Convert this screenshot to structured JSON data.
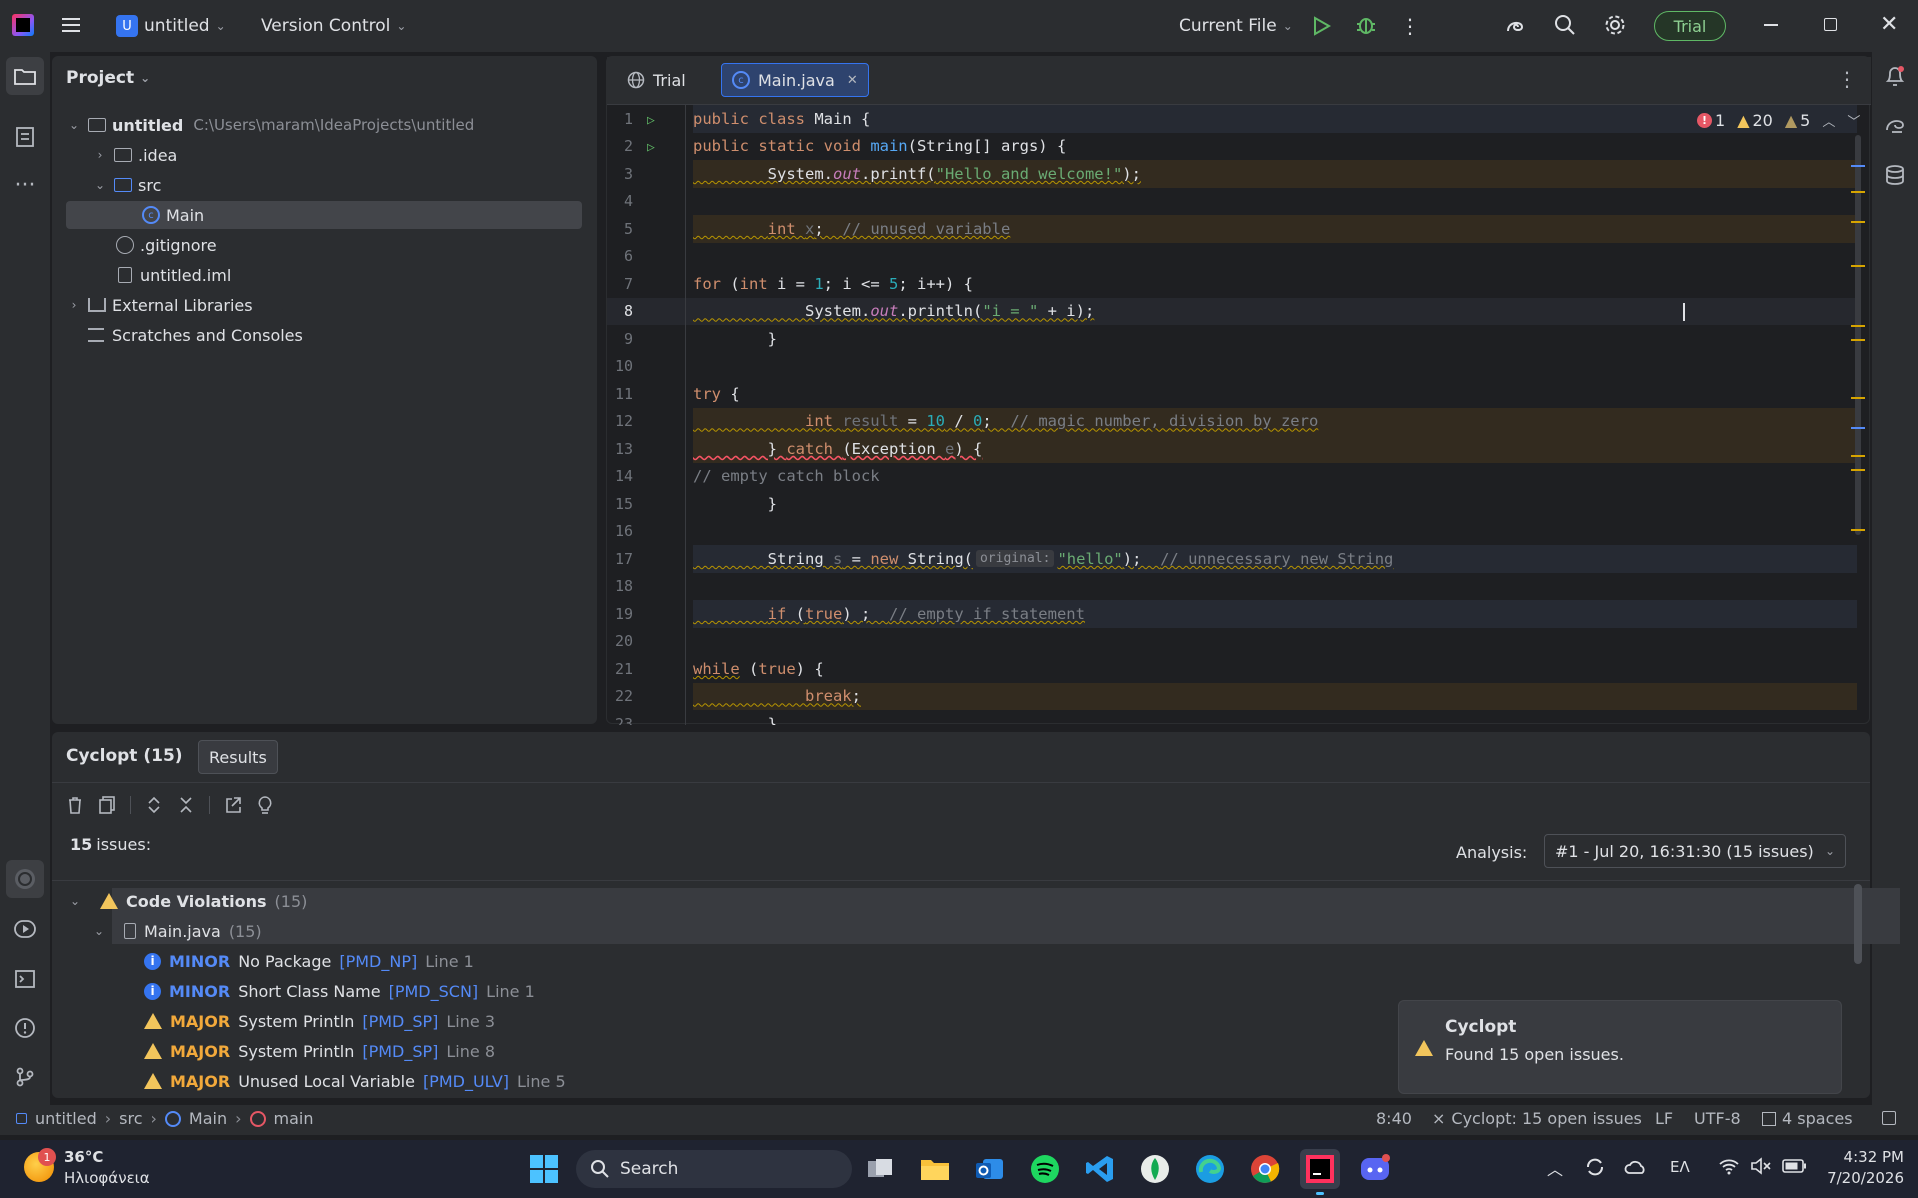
{
  "titlebar": {
    "project_initial": "U",
    "project_name": "untitled",
    "vcs_label": "Version Control",
    "run_config": "Current File",
    "trial_badge": "Trial"
  },
  "project_panel": {
    "title": "Project",
    "root_name": "untitled",
    "root_path": "C:\\Users\\maram\\IdeaProjects\\untitled",
    "items": [
      {
        "label": ".idea"
      },
      {
        "label": "src"
      },
      {
        "label": "Main"
      },
      {
        "label": ".gitignore"
      },
      {
        "label": "untitled.iml"
      },
      {
        "label": "External Libraries"
      },
      {
        "label": "Scratches and Consoles"
      }
    ]
  },
  "editor": {
    "tabs": [
      {
        "label": "Trial"
      },
      {
        "label": "Main.java"
      }
    ],
    "inspections": {
      "errors": "1",
      "warnings": "20",
      "weak_warnings": "5"
    },
    "current_line": "8",
    "inlay_hint": "original:"
  },
  "cyclopt": {
    "title": "Cyclopt (15)",
    "results_tab": "Results",
    "issues_count": "15",
    "issues_label": "issues:",
    "analysis_label": "Analysis:",
    "analysis_value": "#1 - Jul 20, 16:31:30 (15 issues)",
    "group_label": "Code Violations",
    "group_count": "(15)",
    "file_label": "Main.java",
    "file_count": "(15)",
    "issues": [
      {
        "severity": "MINOR",
        "name": "No Package",
        "code": "[PMD_NP]",
        "line": "Line 1"
      },
      {
        "severity": "MINOR",
        "name": "Short Class Name",
        "code": "[PMD_SCN]",
        "line": "Line 1"
      },
      {
        "severity": "MAJOR",
        "name": "System Println",
        "code": "[PMD_SP]",
        "line": "Line 3"
      },
      {
        "severity": "MAJOR",
        "name": "System Println",
        "code": "[PMD_SP]",
        "line": "Line 8"
      },
      {
        "severity": "MAJOR",
        "name": "Unused Local Variable",
        "code": "[PMD_ULV]",
        "line": "Line 5"
      }
    ]
  },
  "notification": {
    "title": "Cyclopt",
    "body": "Found 15 open issues."
  },
  "statusbar": {
    "crumbs": [
      "untitled",
      "src",
      "Main",
      "main"
    ],
    "position": "8:40",
    "cyclopt_status": "Cyclopt: 15 open issues",
    "line_sep": "LF",
    "encoding": "UTF-8",
    "indent": "4 spaces"
  },
  "taskbar": {
    "weather_temp": "36°C",
    "weather_desc": "Ηλιοφάνεια",
    "weather_badge": "1",
    "search_label": "Search",
    "lang": "ΕΛ",
    "time": "4:32 PM",
    "date": "7/20/2026"
  }
}
